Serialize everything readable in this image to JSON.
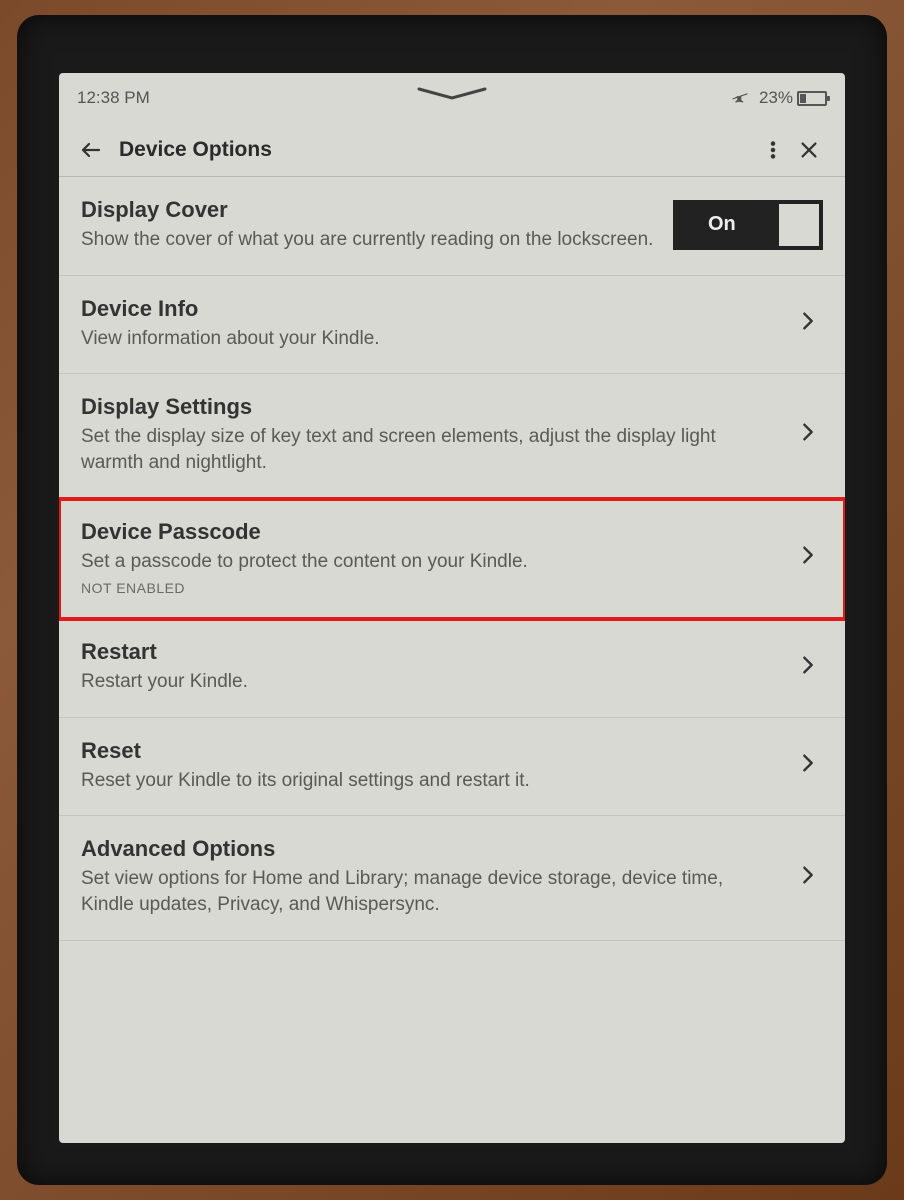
{
  "status": {
    "time": "12:38 PM",
    "battery_pct": "23%"
  },
  "header": {
    "title": "Device Options"
  },
  "toggle": {
    "on_label": "On"
  },
  "rows": {
    "display_cover": {
      "title": "Display Cover",
      "desc": "Show the cover of what you are currently reading on the lockscreen."
    },
    "device_info": {
      "title": "Device Info",
      "desc": "View information about your Kindle."
    },
    "display_settings": {
      "title": "Display Settings",
      "desc": "Set the display size of key text and screen elements, adjust the display light warmth and nightlight."
    },
    "device_passcode": {
      "title": "Device Passcode",
      "desc": "Set a passcode to protect the content on your Kindle.",
      "status": "NOT ENABLED"
    },
    "restart": {
      "title": "Restart",
      "desc": "Restart your Kindle."
    },
    "reset": {
      "title": "Reset",
      "desc": "Reset your Kindle to its original settings and restart it."
    },
    "advanced": {
      "title": "Advanced Options",
      "desc": "Set view options for Home and Library; manage device storage, device time, Kindle updates, Privacy, and Whispersync."
    }
  }
}
